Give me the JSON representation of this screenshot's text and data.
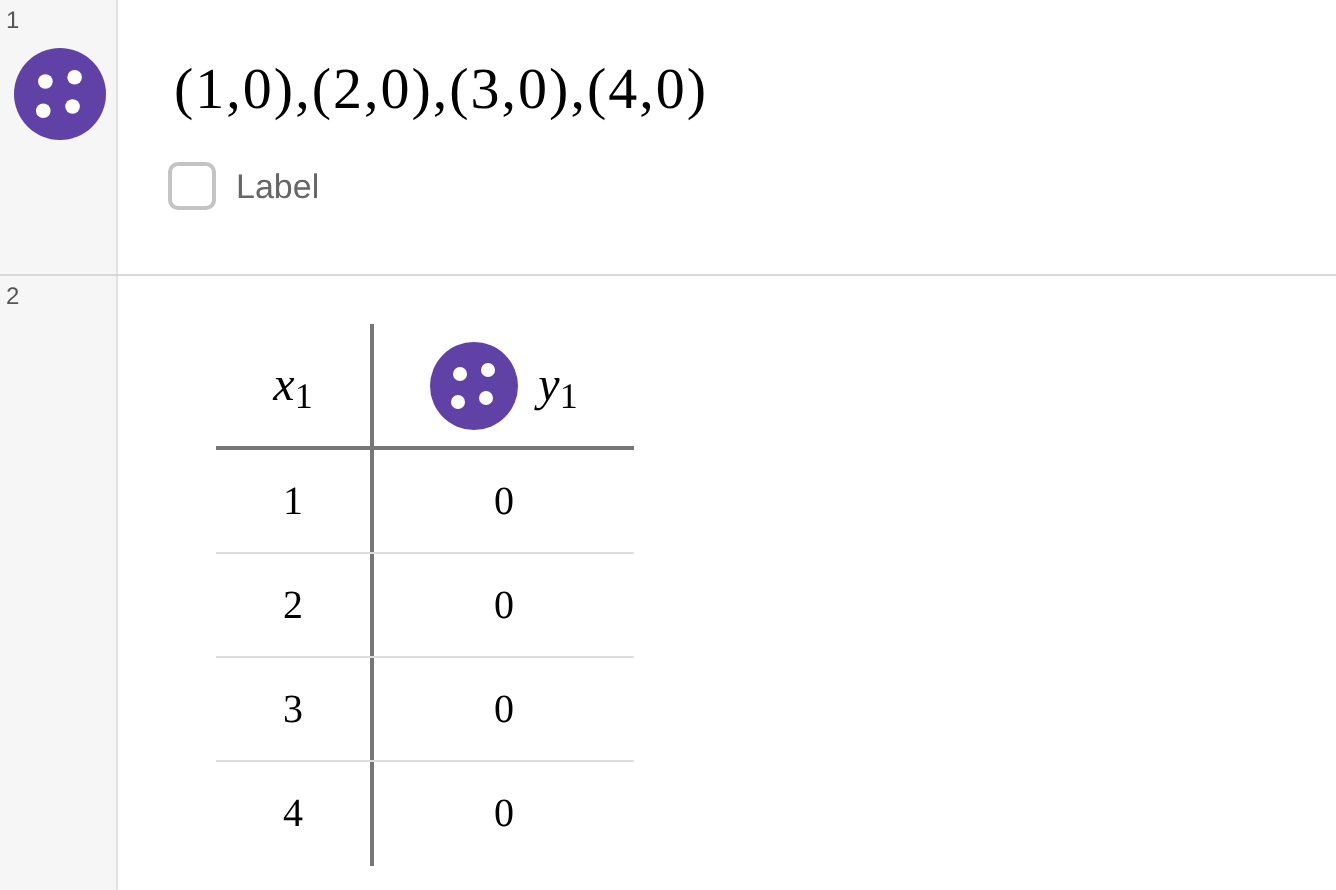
{
  "expressions": [
    {
      "kind": "points",
      "number": "1",
      "color": "#6042a6",
      "text": "(1,0),(2,0),(3,0),(4,0)",
      "label_option": {
        "text": "Label",
        "checked": false
      }
    },
    {
      "kind": "table",
      "number": "2",
      "color": "#6042a6",
      "columns": [
        "*x*$_{1}$",
        "*y*$_{1}$"
      ],
      "rows": [
        [
          "1",
          "0"
        ],
        [
          "2",
          "0"
        ],
        [
          "3",
          "0"
        ],
        [
          "4",
          "0"
        ]
      ]
    }
  ]
}
